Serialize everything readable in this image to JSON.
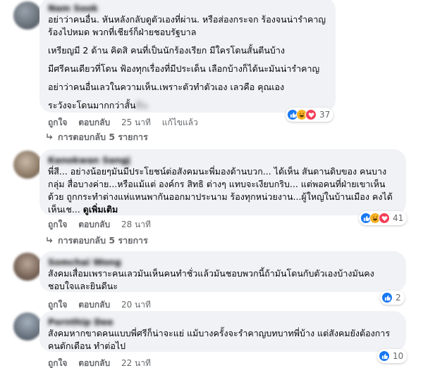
{
  "comments": [
    {
      "author": "Nam Sook",
      "lines": [
        "อย่าว่าคนอื่น. หันหลังกลับดูตัวเองที่ผ่าน. หรือส่องกระจก ร้องจนน่ารำคาญ",
        "ร้องไปหมด พวกที่เชียร์ก็ฝ่ายชอบรัฐบาล",
        "",
        "เหรียญมี 2 ด้าน คิดสิ คนที่เป็นนักร้องเรียก มีใครโดนสั้นตีนบ้าง",
        "",
        "มีศรีคนเดียวที่โดน ฟ้องทุกเรื่องที่มีประเด็น เลือกบ้างก็ได้นะมันน่ารำคาญ",
        "",
        "อย่าว่าคนอื่นเลวในความเห็น.เพราะตัวทำตัวเอง เลวคือ คุณเอง",
        "",
        "ระวังจะโดนมากกว่าสั้น"
      ],
      "blurred_tail": "ตีน",
      "actions": {
        "like": "ถูกใจ",
        "reply": "ตอบกลับ",
        "time": "25 นาที",
        "edited": "แก้ไขแล้ว"
      },
      "reaction_count": "37",
      "replies_label": "การตอบกลับ 5 รายการ"
    },
    {
      "author": "Kanokwan Sangj",
      "lines": [
        "พี่สี... อย่างน้อยๆมันมีประโยชน์ต่อสังคมนะพี่มองด้านบวก... ได้เห็น สันดานดิบของ คนบาง",
        "กลุ่ม สื่อบางค่าย...หรือแม้แต่ องค์กร สิทธิ ต่างๆ แทบจะเงียบกริบ... แต่พอคนที่ฝ่ายเขาเห็น",
        "ด้วย ถูกกระทำต่างแห่แหนพากันออกมาประนาม ร้องทุกหน่วยงาน...ผู้ใหญ่ในบ้านเมือง คงได้",
        "เห็นเช..."
      ],
      "see_more": "ดูเพิ่มเติม",
      "actions": {
        "like": "ถูกใจ",
        "reply": "ตอบกลับ",
        "time": "28 นาที"
      },
      "reaction_count": "41",
      "replies_label": "การตอบกลับ 5 รายการ"
    },
    {
      "author": "Somchai Wong",
      "lines": [
        "สังคมเสื่อมเพราะคนเลวมันเห็นคนทำชั่วแล้วมันชอบพวกนี้ถ้ามันโดนกับตัวเองบ้างมันคง",
        "ชอบใจและยินดีนะ"
      ],
      "actions": {
        "like": "ถูกใจ",
        "reply": "ตอบกลับ",
        "time": "20 นาที"
      },
      "reaction_count": "2"
    },
    {
      "author": "Pornthip Dee",
      "lines": [
        "สังคมหากขาดคนแบบพี่ศรีก็น่าจะแย่ แม้บางครั้งจะรำคาญบทบาทพี่บ้าง แต่สังคมยังต้องการ",
        "คนตักเตือน ทำต่อไป"
      ],
      "actions": {
        "like": "ถูกใจ",
        "reply": "ตอบกลับ",
        "time": "22 นาที"
      },
      "reaction_count": "10"
    }
  ],
  "colors": {
    "like": "#1877f2",
    "haha": "#f7b125",
    "love": "#f33e58",
    "secondary_text": "#65676b",
    "bubble": "#f0f2f5"
  },
  "icons": {
    "like": "thumbs-up-icon",
    "haha": "laughing-face-icon",
    "love": "heart-icon",
    "replies": "reply-arrow-icon"
  }
}
